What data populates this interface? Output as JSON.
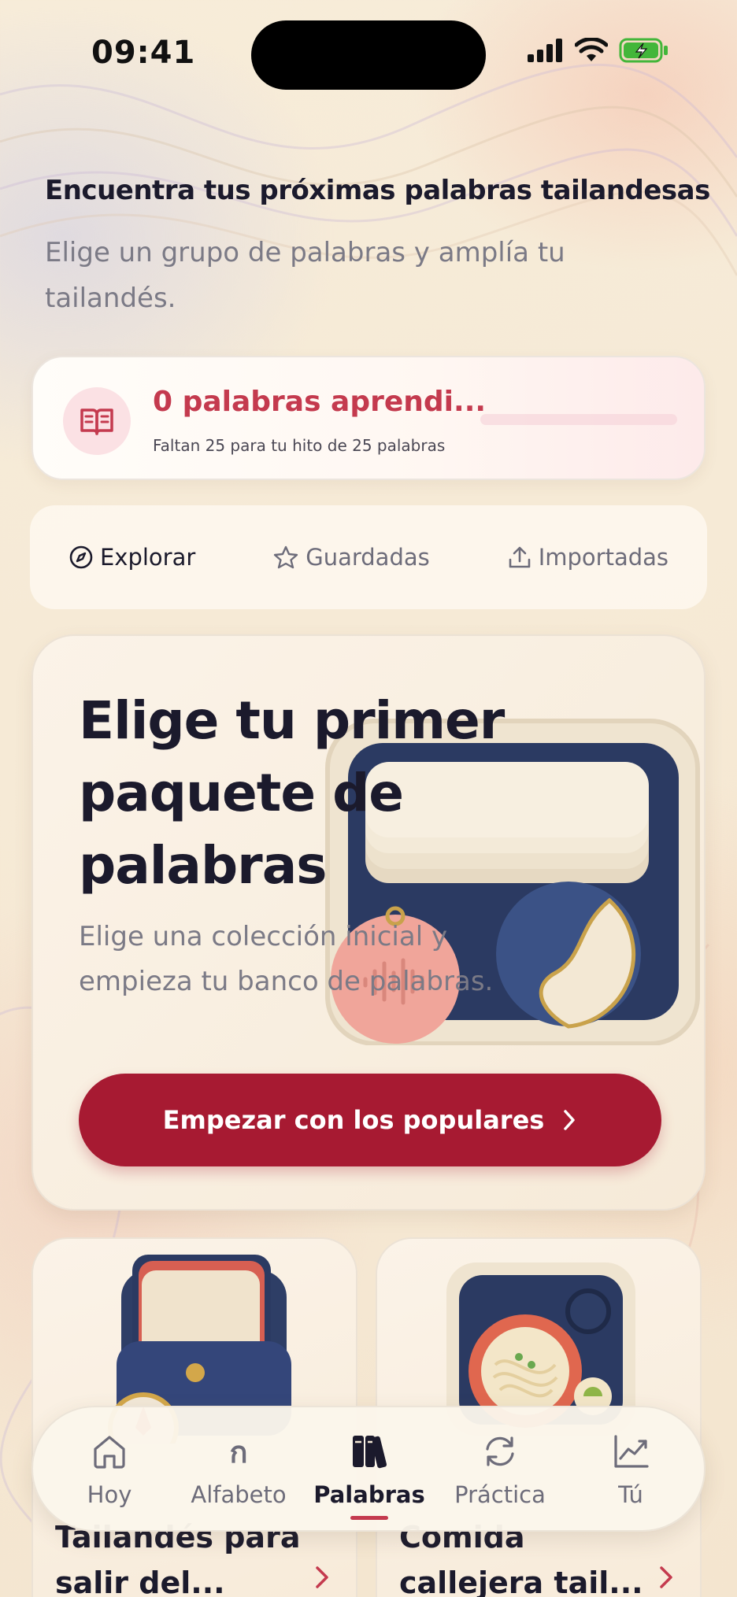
{
  "status_bar": {
    "time": "09:41"
  },
  "header": {
    "title": "Encuentra tus próximas palabras tailandesas",
    "subtitle": "Elige un grupo de palabras y amplía tu tailandés."
  },
  "progress": {
    "title": "0 palabras aprendi...",
    "subtitle": "Faltan 25 para tu hito de 25 palabras",
    "learned": 0,
    "goal": 25,
    "fraction": 0.0
  },
  "tabs": [
    {
      "label": "Explorar",
      "icon": "compass-icon",
      "active": true
    },
    {
      "label": "Guardadas",
      "icon": "star-icon",
      "active": false
    },
    {
      "label": "Importadas",
      "icon": "upload-icon",
      "active": false
    }
  ],
  "hero": {
    "title": "Elige tu primer paquete de palabras",
    "description": "Elige una colección inicial y empieza tu banco de palabras.",
    "button_label": "Empezar con los populares"
  },
  "packs": [
    {
      "title": "Tailandés para salir del..."
    },
    {
      "title": "Comida callejera tail..."
    }
  ],
  "bottom_nav": [
    {
      "label": "Hoy",
      "icon": "home-icon",
      "active": false
    },
    {
      "label": "Alfabeto",
      "icon": "thai-letter-icon",
      "glyph": "ก",
      "active": false
    },
    {
      "label": "Palabras",
      "icon": "books-icon",
      "active": true
    },
    {
      "label": "Práctica",
      "icon": "refresh-icon",
      "active": false
    },
    {
      "label": "Tú",
      "icon": "chart-line-icon",
      "active": false
    }
  ],
  "colors": {
    "accent": "#c43a4e",
    "button": "#a71a32",
    "text_primary": "#1b1a2c",
    "text_secondary": "#7b7a86"
  }
}
